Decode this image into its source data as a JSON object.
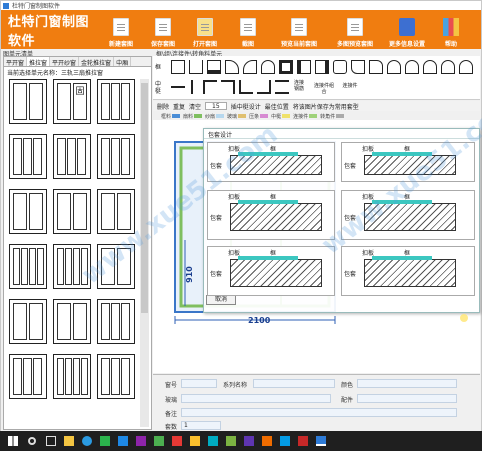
{
  "window": {
    "title": "杜特门窗制图软件"
  },
  "banner": {
    "brand": "杜特门窗制图软件",
    "buttons": [
      "新建套图",
      "保存套图",
      "打开套图",
      "截图",
      "预览当前套图",
      "多图预览套图",
      "更多信息设置",
      "帮助"
    ]
  },
  "breadcrumb": "框\\组\\连接件\\转角料单元",
  "left": {
    "header": "图单元清单",
    "tabs": [
      "平开窗",
      "推拉窗",
      "平开纱窗",
      "金轮推拉窗",
      "中厢"
    ],
    "current_label": "当前选择单元名称：三轨三扇推拉窗"
  },
  "shapebar": {
    "row_label_1": "框",
    "row_label_2": "中梃",
    "joint_labels": [
      "连接钢筋",
      "连接件组合",
      "连接件"
    ]
  },
  "toolbar2": {
    "delete": "删除",
    "redo": "重复",
    "clear": "清空",
    "size_value": "15",
    "middle_frame": "插中梃设计",
    "best_position": "最佳位置",
    "save_image": "将该图片保存为常用套型"
  },
  "legend": [
    "框料",
    "扇料",
    "纱扇",
    "玻璃",
    "压条",
    "中梃",
    "连接件",
    "转角件"
  ],
  "dialog": {
    "title": "包套设计",
    "cancel": "取消",
    "labels": {
      "flash": "扣板",
      "frame": "框",
      "wrap": "包套"
    }
  },
  "dimensions": {
    "width": "2100",
    "height": "910"
  },
  "form": {
    "labels": [
      "窗号",
      "系列名称",
      "颜色",
      "玻璃",
      "配件",
      "备注",
      "套数"
    ],
    "quantity_value": "1"
  },
  "watermark": "www.xue51.com",
  "colors": {
    "banner": "#f07d10",
    "accent": "#2e7bd6",
    "glass": "#3cc7c0"
  }
}
